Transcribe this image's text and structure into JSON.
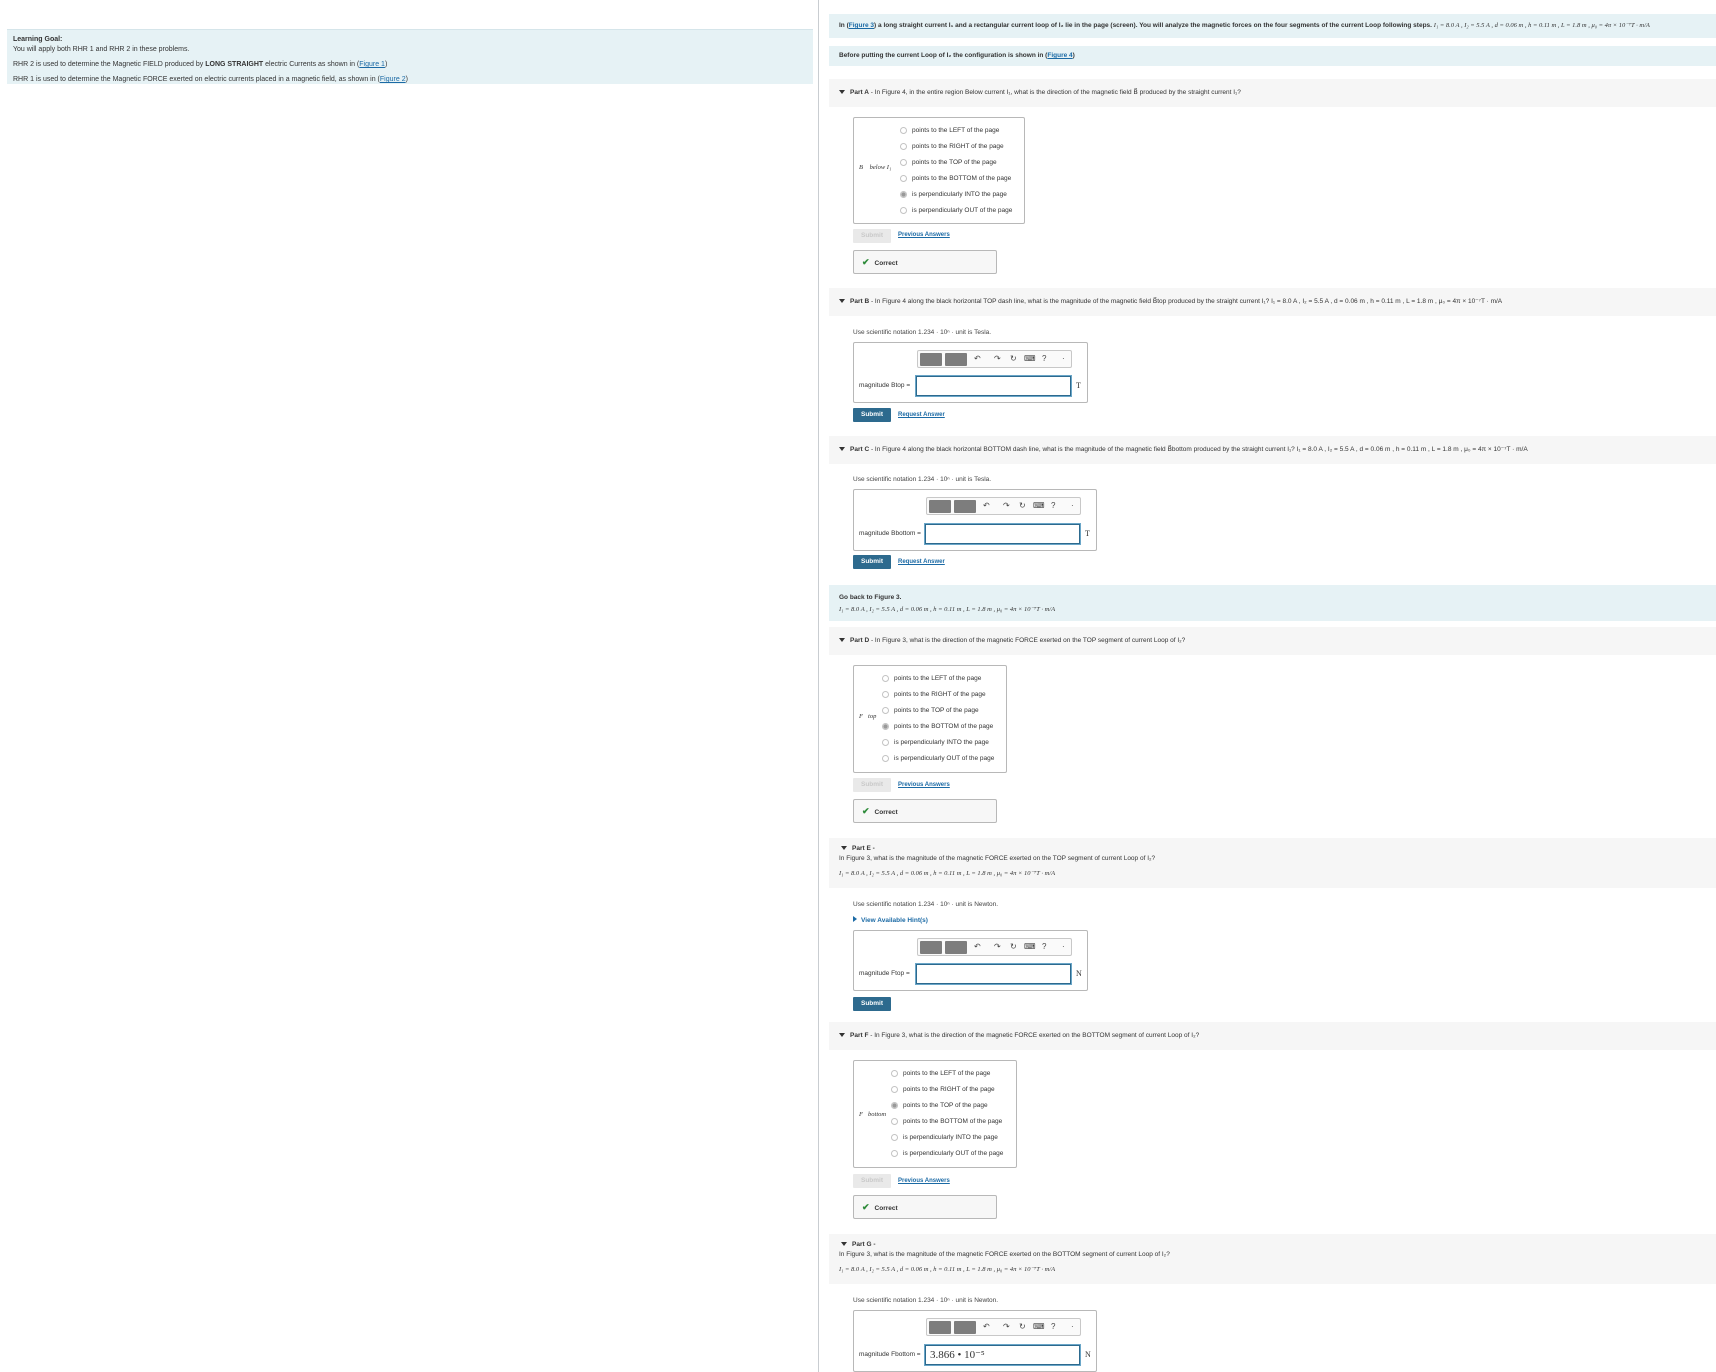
{
  "left": {
    "goal_title": "Learning Goal:",
    "line1": "You will apply both RHR 1 and RHR 2 in these problems.",
    "line2_pre": "RHR 2 is used to determine the Magnetic FIELD produced by ",
    "line2_bold": "LONG STRAIGHT",
    "line2_post": " electric Currents as shown in (",
    "line2_link": "Figure 1",
    "line3_pre": "RHR 1 is used to determine the Magnetic FORCE exerted on electric currents placed in a magnetic field, as shown in (",
    "line3_link": "Figure 2",
    "close_paren": ")"
  },
  "intro": {
    "pre": "In (",
    "link": "Figure 3",
    "post": ") a long straight current I₁ and a rectangular current loop of I₂ lie in the page (screen). You will analyze the magnetic forces on the four segments of the current Loop following steps.",
    "params": "I₁ = 8.0 A , I₂ = 5.5 A , d = 0.06 m , h = 0.11 m , L = 1.8 m , μ₀ = 4π × 10⁻⁷T · m/A"
  },
  "before": {
    "pre": "Before putting the current Loop of I₂ the configuration is shown in (",
    "link": "Figure 4",
    "post": ")"
  },
  "options": [
    "points to the LEFT of the page",
    "points to the RIGHT of the page",
    "points to the TOP of the page",
    "points to the BOTTOM of the page",
    "is perpendicularly INTO the page",
    "is perpendicularly OUT of the page"
  ],
  "common": {
    "submit": "Submit",
    "previous_answers": "Previous Answers",
    "request_answer": "Request Answer",
    "correct": "Correct",
    "notation_tesla": "Use scientific notation 1.234 · 10ⁿ · unit is Tesla.",
    "notation_newton": "Use scientific notation 1.234 · 10ⁿ · unit is Newton.",
    "hint": "View Available Hint(s)",
    "unit_T": "T",
    "unit_N": "N"
  },
  "partA": {
    "title": "Part A",
    "question": " - In Figure 4, in the entire region Below current I₁, what is the direction of the magnetic field B⃗ produced by the straight current I₁?",
    "label": "B⃗ below I₁",
    "selected": 4
  },
  "partB": {
    "title": "Part B",
    "question": " - In Figure 4 along the black horizontal TOP dash line, what is the magnitude of the magnetic field B⃗top produced by the straight current I₁? I₁ = 8.0 A , I₂ = 5.5 A , d = 0.06 m , h = 0.11 m , L = 1.8 m , μ₀ = 4π × 10⁻⁷T · m/A",
    "label": "magnitude Btop =",
    "value": ""
  },
  "partC": {
    "title": "Part C",
    "question": " - In Figure 4 along the black horizontal BOTTOM dash line, what is the magnitude of the magnetic field B⃗bottom produced by the straight current I₁? I₁ = 8.0 A , I₂ = 5.5 A , d = 0.06 m , h = 0.11 m , L = 1.8 m , μ₀ = 4π × 10⁻⁷T · m/A",
    "label": "magnitude Bbottom =",
    "value": ""
  },
  "goback": {
    "title": "Go back to Figure 3.",
    "params": "I₁ = 8.0 A , I₂ = 5.5 A , d = 0.06 m , h = 0.11 m , L = 1.8 m , μ₀ = 4π × 10⁻⁷T · m/A"
  },
  "partD": {
    "title": "Part D",
    "question": " - In Figure 3, what is the direction of the magnetic FORCE exerted on the TOP segment of current Loop of I₂?",
    "label": "F⃗top",
    "selected": 3
  },
  "partE": {
    "title": "Part E",
    "dash": " -",
    "question": "In Figure 3, what is the magnitude of the magnetic FORCE exerted on the TOP segment of current Loop of I₂?",
    "params": "I₁ = 8.0 A , I₂ = 5.5 A , d = 0.06 m , h = 0.11 m , L = 1.8 m , μ₀ = 4π × 10⁻⁷T · m/A",
    "label": "magnitude Ftop =",
    "value": ""
  },
  "partF": {
    "title": "Part F",
    "question": " - In Figure 3, what is the direction of the magnetic FORCE exerted on the BOTTOM segment of current Loop of I₂?",
    "label": "F⃗bottom",
    "selected": 2
  },
  "partG": {
    "title": "Part G",
    "dash": " -",
    "question": "In Figure 3, what is the magnitude of the magnetic FORCE exerted on the BOTTOM segment of current Loop of I₂?",
    "params": "I₁ = 8.0 A , I₂ = 5.5 A , d = 0.06 m , h = 0.11 m , L = 1.8 m , μ₀ = 4π × 10⁻⁷T · m/A",
    "label": "magnitude Fbottom =",
    "value": "3.866 • 10⁻⁵"
  }
}
